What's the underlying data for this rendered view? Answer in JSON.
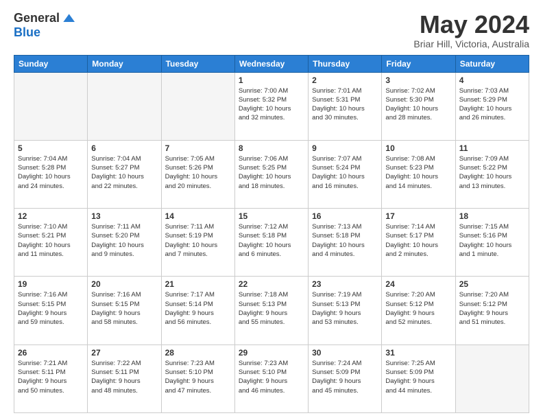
{
  "header": {
    "logo": {
      "general": "General",
      "blue": "Blue"
    },
    "title": "May 2024",
    "subtitle": "Briar Hill, Victoria, Australia"
  },
  "weekdays": [
    "Sunday",
    "Monday",
    "Tuesday",
    "Wednesday",
    "Thursday",
    "Friday",
    "Saturday"
  ],
  "weeks": [
    [
      {
        "day": "",
        "info": ""
      },
      {
        "day": "",
        "info": ""
      },
      {
        "day": "",
        "info": ""
      },
      {
        "day": "1",
        "info": "Sunrise: 7:00 AM\nSunset: 5:32 PM\nDaylight: 10 hours\nand 32 minutes."
      },
      {
        "day": "2",
        "info": "Sunrise: 7:01 AM\nSunset: 5:31 PM\nDaylight: 10 hours\nand 30 minutes."
      },
      {
        "day": "3",
        "info": "Sunrise: 7:02 AM\nSunset: 5:30 PM\nDaylight: 10 hours\nand 28 minutes."
      },
      {
        "day": "4",
        "info": "Sunrise: 7:03 AM\nSunset: 5:29 PM\nDaylight: 10 hours\nand 26 minutes."
      }
    ],
    [
      {
        "day": "5",
        "info": "Sunrise: 7:04 AM\nSunset: 5:28 PM\nDaylight: 10 hours\nand 24 minutes."
      },
      {
        "day": "6",
        "info": "Sunrise: 7:04 AM\nSunset: 5:27 PM\nDaylight: 10 hours\nand 22 minutes."
      },
      {
        "day": "7",
        "info": "Sunrise: 7:05 AM\nSunset: 5:26 PM\nDaylight: 10 hours\nand 20 minutes."
      },
      {
        "day": "8",
        "info": "Sunrise: 7:06 AM\nSunset: 5:25 PM\nDaylight: 10 hours\nand 18 minutes."
      },
      {
        "day": "9",
        "info": "Sunrise: 7:07 AM\nSunset: 5:24 PM\nDaylight: 10 hours\nand 16 minutes."
      },
      {
        "day": "10",
        "info": "Sunrise: 7:08 AM\nSunset: 5:23 PM\nDaylight: 10 hours\nand 14 minutes."
      },
      {
        "day": "11",
        "info": "Sunrise: 7:09 AM\nSunset: 5:22 PM\nDaylight: 10 hours\nand 13 minutes."
      }
    ],
    [
      {
        "day": "12",
        "info": "Sunrise: 7:10 AM\nSunset: 5:21 PM\nDaylight: 10 hours\nand 11 minutes."
      },
      {
        "day": "13",
        "info": "Sunrise: 7:11 AM\nSunset: 5:20 PM\nDaylight: 10 hours\nand 9 minutes."
      },
      {
        "day": "14",
        "info": "Sunrise: 7:11 AM\nSunset: 5:19 PM\nDaylight: 10 hours\nand 7 minutes."
      },
      {
        "day": "15",
        "info": "Sunrise: 7:12 AM\nSunset: 5:18 PM\nDaylight: 10 hours\nand 6 minutes."
      },
      {
        "day": "16",
        "info": "Sunrise: 7:13 AM\nSunset: 5:18 PM\nDaylight: 10 hours\nand 4 minutes."
      },
      {
        "day": "17",
        "info": "Sunrise: 7:14 AM\nSunset: 5:17 PM\nDaylight: 10 hours\nand 2 minutes."
      },
      {
        "day": "18",
        "info": "Sunrise: 7:15 AM\nSunset: 5:16 PM\nDaylight: 10 hours\nand 1 minute."
      }
    ],
    [
      {
        "day": "19",
        "info": "Sunrise: 7:16 AM\nSunset: 5:15 PM\nDaylight: 9 hours\nand 59 minutes."
      },
      {
        "day": "20",
        "info": "Sunrise: 7:16 AM\nSunset: 5:15 PM\nDaylight: 9 hours\nand 58 minutes."
      },
      {
        "day": "21",
        "info": "Sunrise: 7:17 AM\nSunset: 5:14 PM\nDaylight: 9 hours\nand 56 minutes."
      },
      {
        "day": "22",
        "info": "Sunrise: 7:18 AM\nSunset: 5:13 PM\nDaylight: 9 hours\nand 55 minutes."
      },
      {
        "day": "23",
        "info": "Sunrise: 7:19 AM\nSunset: 5:13 PM\nDaylight: 9 hours\nand 53 minutes."
      },
      {
        "day": "24",
        "info": "Sunrise: 7:20 AM\nSunset: 5:12 PM\nDaylight: 9 hours\nand 52 minutes."
      },
      {
        "day": "25",
        "info": "Sunrise: 7:20 AM\nSunset: 5:12 PM\nDaylight: 9 hours\nand 51 minutes."
      }
    ],
    [
      {
        "day": "26",
        "info": "Sunrise: 7:21 AM\nSunset: 5:11 PM\nDaylight: 9 hours\nand 50 minutes."
      },
      {
        "day": "27",
        "info": "Sunrise: 7:22 AM\nSunset: 5:11 PM\nDaylight: 9 hours\nand 48 minutes."
      },
      {
        "day": "28",
        "info": "Sunrise: 7:23 AM\nSunset: 5:10 PM\nDaylight: 9 hours\nand 47 minutes."
      },
      {
        "day": "29",
        "info": "Sunrise: 7:23 AM\nSunset: 5:10 PM\nDaylight: 9 hours\nand 46 minutes."
      },
      {
        "day": "30",
        "info": "Sunrise: 7:24 AM\nSunset: 5:09 PM\nDaylight: 9 hours\nand 45 minutes."
      },
      {
        "day": "31",
        "info": "Sunrise: 7:25 AM\nSunset: 5:09 PM\nDaylight: 9 hours\nand 44 minutes."
      },
      {
        "day": "",
        "info": ""
      }
    ]
  ]
}
